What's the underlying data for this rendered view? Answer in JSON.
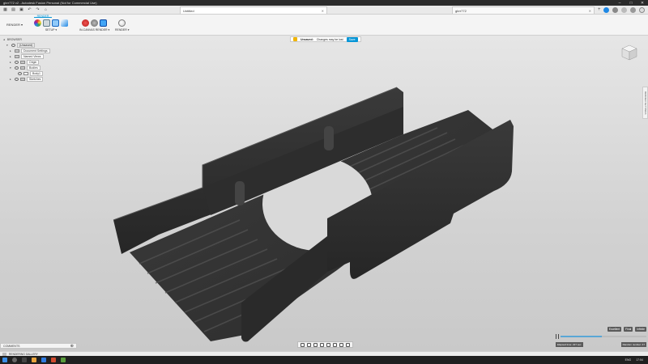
{
  "titlebar": {
    "title": "gbrr772 v2 - Autodesk Fusion Personal (Not for Commercial Use)",
    "minimize": "–",
    "maximize": "□",
    "close": "✕"
  },
  "tabbar": {
    "tab_untitled": "Untitled",
    "tab_active": "gbrr772",
    "new_tab": "+"
  },
  "ribbon": {
    "workspace": "RENDER ▾",
    "active_tab": "RENDER",
    "groups": {
      "setup": "SETUP ▾",
      "in_canvas_render": "IN-CANVAS RENDER ▾",
      "render": "RENDER ▾"
    }
  },
  "notification": {
    "title": "Unsaved:",
    "message": "Changes may be lost",
    "save_label": "Save"
  },
  "browser": {
    "header": "BROWSER",
    "root": "(Unsaved)",
    "items": [
      {
        "label": "Document Settings"
      },
      {
        "label": "Named Views"
      },
      {
        "label": "Origin"
      },
      {
        "label": "Bodies"
      },
      {
        "label": "Body1"
      },
      {
        "label": "Sketches"
      }
    ]
  },
  "side_tab": "RENDER SETTINGS",
  "render_controls": {
    "buttons": [
      "Excellent",
      "Final",
      "Infinite"
    ],
    "progress": 0.48,
    "elapsed": "Elapsed time: 227 sec",
    "random": "Random number: 47"
  },
  "comments": {
    "label": "COMMENTS",
    "add": "⊕"
  },
  "status": {
    "text": "RENDERING GALLERY"
  },
  "taskbar": {
    "language": "ENG",
    "time": "17:54"
  },
  "colors": {
    "accent": "#0696d7",
    "model": "#2f2f2f",
    "warning": "#f0b400"
  },
  "icons": {
    "cube": "view-cube-icon",
    "search": "search-icon",
    "warning": "warning-icon"
  }
}
